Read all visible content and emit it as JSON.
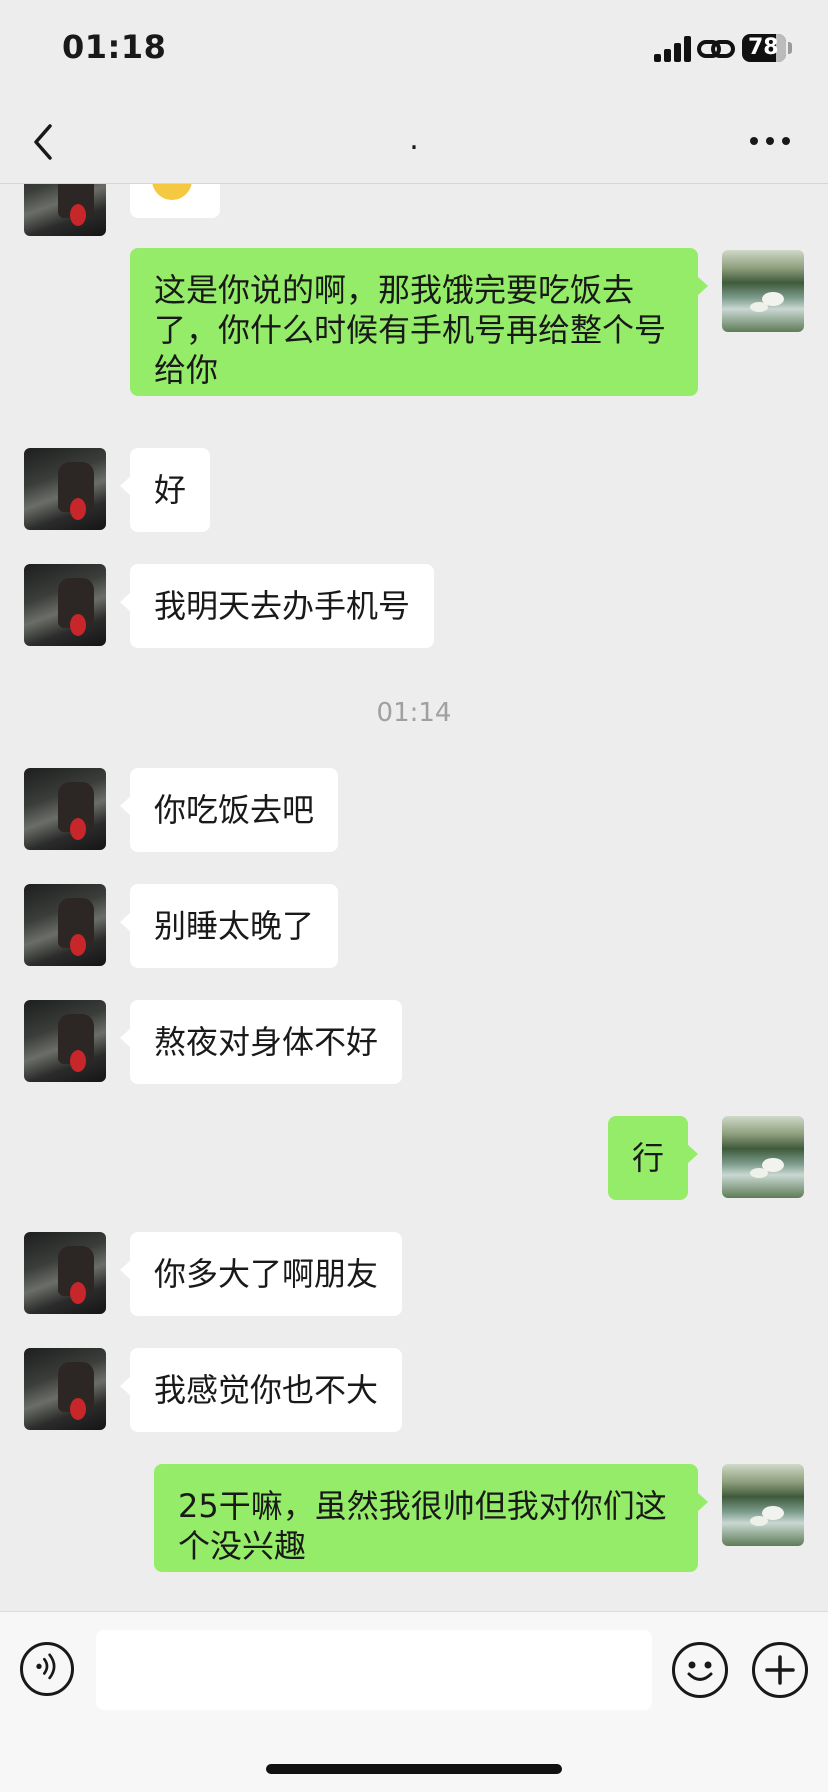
{
  "status_bar": {
    "time": "01:18",
    "battery": "78"
  },
  "nav": {
    "title": "."
  },
  "messages": [
    {
      "side": "them",
      "text": ""
    },
    {
      "side": "me",
      "text": "这是你说的啊，那我饿完要吃饭去了，你什么时候有手机号再给整个号给你"
    },
    {
      "side": "them",
      "text": "好"
    },
    {
      "side": "them",
      "text": "我明天去办手机号"
    },
    {
      "side": "time",
      "text": "01:14"
    },
    {
      "side": "them",
      "text": "你吃饭去吧"
    },
    {
      "side": "them",
      "text": "别睡太晚了"
    },
    {
      "side": "them",
      "text": "熬夜对身体不好"
    },
    {
      "side": "me",
      "text": "行"
    },
    {
      "side": "them",
      "text": "你多大了啊朋友"
    },
    {
      "side": "them",
      "text": "我感觉你也不大"
    },
    {
      "side": "me",
      "text": "25干嘛，虽然我很帅但我对你们这个没兴趣"
    }
  ],
  "input_bar": {
    "value": "",
    "icons": [
      "voice-icon",
      "emoji-icon",
      "plus-icon"
    ]
  },
  "colors": {
    "background": "#ededed",
    "my_bubble": "#95ec69",
    "their_bubble": "#ffffff",
    "timestamp": "#a0a0a0"
  }
}
